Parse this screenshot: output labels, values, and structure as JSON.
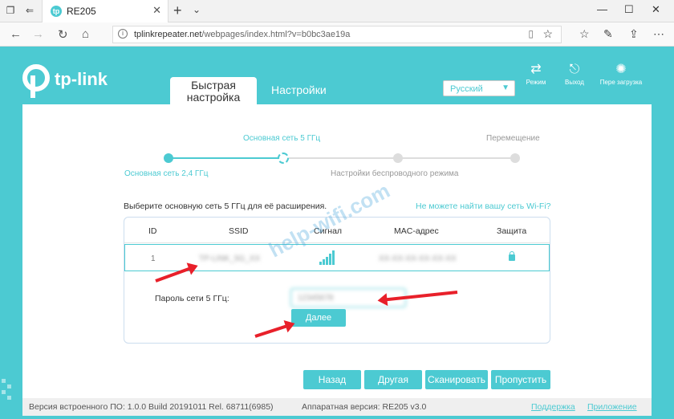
{
  "browser": {
    "tab_title": "RE205",
    "tab_favicon": "tp",
    "url": "tplinkrepeater.net",
    "url_path": "/webpages/index.html?v=b0bc3ae19a"
  },
  "header": {
    "logo_text": "tp-link",
    "tab_quick_setup": "Быстрая настройка",
    "tab_settings": "Настройки",
    "language": "Русский",
    "icons": [
      {
        "label": "Режим",
        "icon": "mode-icon"
      },
      {
        "label": "Выход",
        "icon": "logout-icon"
      },
      {
        "label": "Пере загрузка",
        "icon": "reboot-icon"
      }
    ]
  },
  "steps": {
    "step1": "Основная сеть 2,4 ГГц",
    "step2": "Основная сеть 5 ГГц",
    "step3": "Настройки беспроводного режима",
    "step4": "Перемещение"
  },
  "main": {
    "prompt": "Выберите основную сеть 5 ГГц для её расширения.",
    "cant_find": "Не можете найти вашу сеть Wi-Fi?",
    "columns": [
      "ID",
      "SSID",
      "Сигнал",
      "MAC-адрес",
      "Защита"
    ],
    "row": {
      "id": "1",
      "ssid": "TP-LINK_5G_XX",
      "mac": "XX-XX-XX-XX-XX-XX"
    },
    "password_label": "Пароль сети 5 ГГц:",
    "password_value": "12345678",
    "next_button": "Далее"
  },
  "buttons": {
    "back": "Назад",
    "other": "Другая",
    "scan": "Сканировать",
    "skip": "Пропустить"
  },
  "footer": {
    "firmware": "Версия встроенного ПО: 1.0.0 Build 20191011 Rel. 68711(6985)",
    "hardware": "Аппаратная версия: RE205 v3.0",
    "support": "Поддержка",
    "app": "Приложение"
  },
  "watermark": "help-wifi.com",
  "colors": {
    "accent": "#4ccad2",
    "arrow": "#e8202a"
  }
}
